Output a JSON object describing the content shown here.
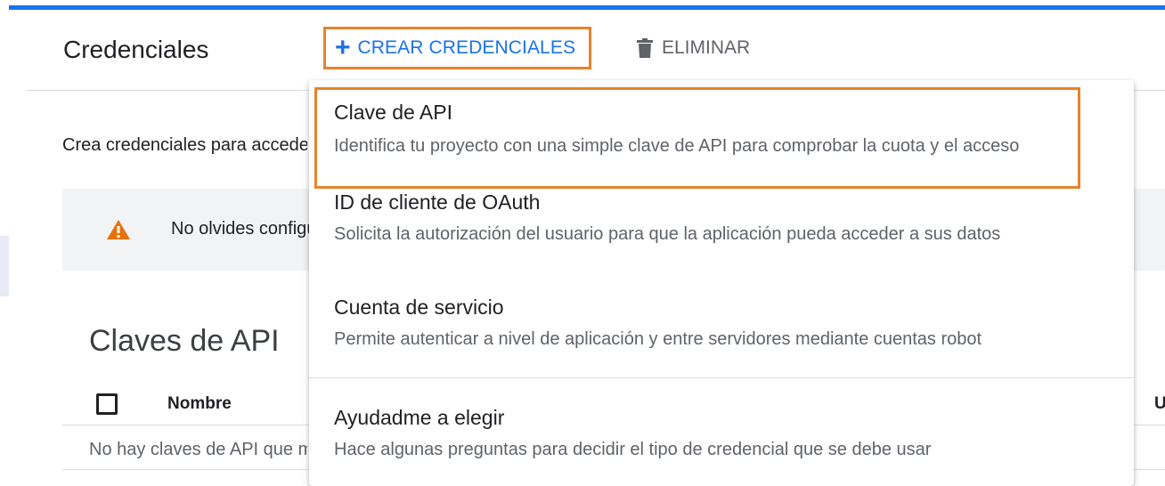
{
  "header": {
    "title": "Credenciales",
    "create_label": "CREAR CREDENCIALES",
    "delete_label": "ELIMINAR"
  },
  "main": {
    "description": "Crea credenciales para acceder a tus API habilitadas",
    "warning": "No olvides configurar",
    "section_title": "Claves de API",
    "table": {
      "columns": [
        "Nombre",
        "U"
      ],
      "empty_text": "No hay claves de API que mostrar"
    }
  },
  "menu": {
    "items": [
      {
        "title": "Clave de API",
        "subtitle": "Identifica tu proyecto con una simple clave de API para comprobar la cuota y el acceso"
      },
      {
        "title": "ID de cliente de OAuth",
        "subtitle": "Solicita la autorización del usuario para que la aplicación pueda acceder a sus datos"
      },
      {
        "title": "Cuenta de servicio",
        "subtitle": "Permite autenticar a nivel de aplicación y entre servidores mediante cuentas robot"
      },
      {
        "title": "Ayudadme a elegir",
        "subtitle": "Hace algunas preguntas para decidir el tipo de credencial que se debe usar"
      }
    ]
  },
  "colors": {
    "accent": "#1a73e8",
    "highlight": "#e8822a",
    "warning": "#e8710a"
  },
  "icons": {
    "create": "plus-icon",
    "delete": "trash-icon",
    "warning": "warning-icon"
  }
}
